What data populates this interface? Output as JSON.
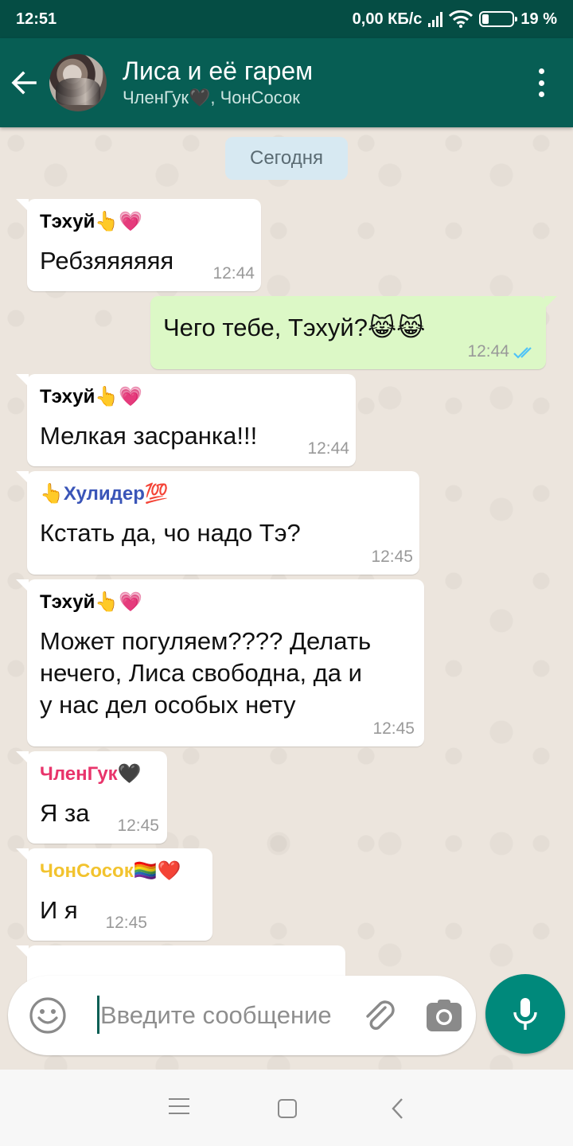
{
  "status_bar": {
    "time": "12:51",
    "network_speed": "0,00 КБ/с",
    "battery": "19 %"
  },
  "header": {
    "title": "Лиса и её гарем",
    "subtitle": "ЧленГук🖤, ЧонСосок"
  },
  "chat": {
    "date_chip": "Сегодня",
    "messages": [
      {
        "sender": "Тэхуй👆💗",
        "sender_color": "#000000",
        "text": "Ребзяяяяяя",
        "time": "12:44",
        "outgoing": false
      },
      {
        "text": "Чего тебе, Тэхуй?😹😹",
        "time": "12:44",
        "outgoing": true,
        "status": "read"
      },
      {
        "sender": "Тэхуй👆💗",
        "sender_color": "#000000",
        "text": "Мелкая засранка!!!",
        "time": "12:44",
        "outgoing": false
      },
      {
        "sender": "👆Хулидер💯",
        "sender_color": "#3a55b8",
        "text": "Кстать да, чо надо Тэ?",
        "time": "12:45",
        "outgoing": false
      },
      {
        "sender": "Тэхуй👆💗",
        "sender_color": "#000000",
        "text_lines": [
          "Может погуляем???? Делать",
          "нечего, Лиса свободна, да и",
          "у нас дел особых нету"
        ],
        "time": "12:45",
        "outgoing": false
      },
      {
        "sender": "ЧленГук🖤",
        "sender_color": "#e8346b",
        "text": "Я за",
        "time": "12:45",
        "outgoing": false
      },
      {
        "sender": "ЧонСосок🏳️‍🌈❤️",
        "sender_color": "#f2c32e",
        "text": "И я",
        "time": "12:45",
        "outgoing": false
      }
    ]
  },
  "composer": {
    "placeholder": "Введите сообщение"
  },
  "icons": {
    "back": "arrow-left-icon",
    "menu": "more-vert-icon",
    "emoji": "smile-icon",
    "attach": "paperclip-icon",
    "camera": "camera-icon",
    "mic": "mic-icon"
  },
  "colors": {
    "header": "#075e54",
    "status_bar": "#054d44",
    "outgoing_bubble": "#dcf8c6",
    "incoming_bubble": "#ffffff",
    "accent": "#00897b",
    "read_ticks": "#4fc3f7"
  }
}
